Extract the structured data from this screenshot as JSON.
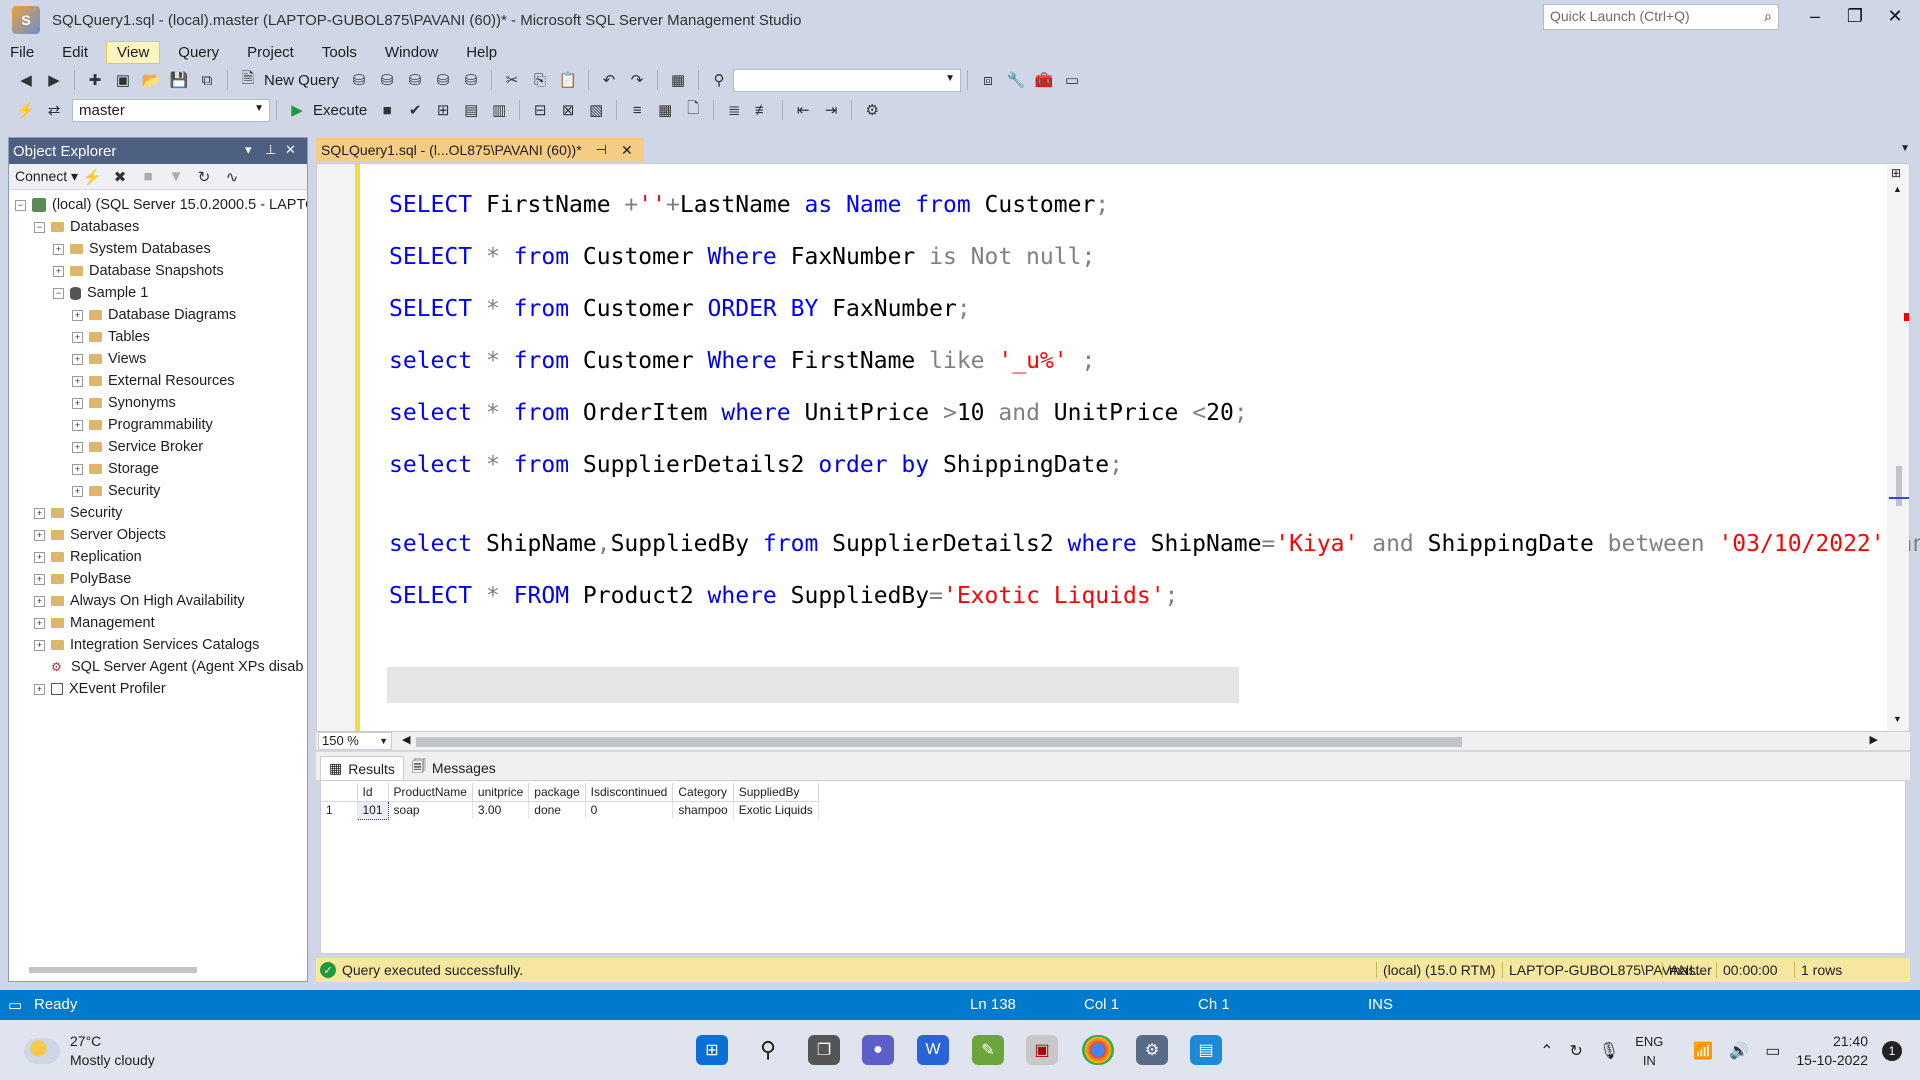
{
  "window": {
    "title": "SQLQuery1.sql - (local).master (LAPTOP-GUBOL875\\PAVANI (60))* - Microsoft SQL Server Management Studio",
    "quick_launch_placeholder": "Quick Launch (Ctrl+Q)"
  },
  "menu": [
    "File",
    "Edit",
    "View",
    "Query",
    "Project",
    "Tools",
    "Window",
    "Help"
  ],
  "menu_active": "View",
  "toolbar1": {
    "new_query_label": "New Query"
  },
  "toolbar2": {
    "database": "master",
    "execute_label": "Execute"
  },
  "object_explorer": {
    "title": "Object Explorer",
    "connect_label": "Connect",
    "tree": [
      {
        "label": "(local) (SQL Server 15.0.2000.5 - LAPTO",
        "indent": 0,
        "exp": "−",
        "icon": "server"
      },
      {
        "label": "Databases",
        "indent": 1,
        "exp": "−",
        "icon": "folder"
      },
      {
        "label": "System Databases",
        "indent": 2,
        "exp": "+",
        "icon": "folder"
      },
      {
        "label": "Database Snapshots",
        "indent": 2,
        "exp": "+",
        "icon": "folder"
      },
      {
        "label": "Sample 1",
        "indent": 2,
        "exp": "−",
        "icon": "db"
      },
      {
        "label": "Database Diagrams",
        "indent": 3,
        "exp": "+",
        "icon": "folder"
      },
      {
        "label": "Tables",
        "indent": 3,
        "exp": "+",
        "icon": "folder"
      },
      {
        "label": "Views",
        "indent": 3,
        "exp": "+",
        "icon": "folder"
      },
      {
        "label": "External Resources",
        "indent": 3,
        "exp": "+",
        "icon": "folder"
      },
      {
        "label": "Synonyms",
        "indent": 3,
        "exp": "+",
        "icon": "folder"
      },
      {
        "label": "Programmability",
        "indent": 3,
        "exp": "+",
        "icon": "folder"
      },
      {
        "label": "Service Broker",
        "indent": 3,
        "exp": "+",
        "icon": "folder"
      },
      {
        "label": "Storage",
        "indent": 3,
        "exp": "+",
        "icon": "folder"
      },
      {
        "label": "Security",
        "indent": 3,
        "exp": "+",
        "icon": "folder"
      },
      {
        "label": "Security",
        "indent": 1,
        "exp": "+",
        "icon": "folder"
      },
      {
        "label": "Server Objects",
        "indent": 1,
        "exp": "+",
        "icon": "folder"
      },
      {
        "label": "Replication",
        "indent": 1,
        "exp": "+",
        "icon": "folder"
      },
      {
        "label": "PolyBase",
        "indent": 1,
        "exp": "+",
        "icon": "folder"
      },
      {
        "label": "Always On High Availability",
        "indent": 1,
        "exp": "+",
        "icon": "folder"
      },
      {
        "label": "Management",
        "indent": 1,
        "exp": "+",
        "icon": "folder"
      },
      {
        "label": "Integration Services Catalogs",
        "indent": 1,
        "exp": "+",
        "icon": "folder"
      },
      {
        "label": "SQL Server Agent (Agent XPs disab",
        "indent": 1,
        "exp": "",
        "icon": "agent"
      },
      {
        "label": "XEvent Profiler",
        "indent": 1,
        "exp": "+",
        "icon": "xe"
      }
    ]
  },
  "doc_tab": {
    "label": "SQLQuery1.sql - (l...OL875\\PAVANI (60))*"
  },
  "editor": {
    "lines": [
      [
        [
          "kw",
          "SELECT"
        ],
        [
          "id",
          " FirstName "
        ],
        [
          "op",
          "+"
        ],
        [
          "str",
          "''"
        ],
        [
          "op",
          "+"
        ],
        [
          "id",
          "LastName "
        ],
        [
          "kw",
          "as"
        ],
        [
          "id",
          " "
        ],
        [
          "kw",
          "Name"
        ],
        [
          "id",
          " "
        ],
        [
          "kw",
          "from"
        ],
        [
          "id",
          " Customer"
        ],
        [
          "op",
          ";"
        ]
      ],
      [
        [
          "kw",
          "SELECT"
        ],
        [
          "id",
          " "
        ],
        [
          "op",
          "*"
        ],
        [
          "id",
          " "
        ],
        [
          "kw",
          "from"
        ],
        [
          "id",
          " Customer "
        ],
        [
          "kw",
          "Where"
        ],
        [
          "id",
          " FaxNumber "
        ],
        [
          "op",
          "is Not null;"
        ]
      ],
      [
        [
          "kw",
          "SELECT"
        ],
        [
          "id",
          " "
        ],
        [
          "op",
          "*"
        ],
        [
          "id",
          " "
        ],
        [
          "kw",
          "from"
        ],
        [
          "id",
          " Customer "
        ],
        [
          "kw",
          "ORDER BY"
        ],
        [
          "id",
          " FaxNumber"
        ],
        [
          "op",
          ";"
        ]
      ],
      [
        [
          "kw",
          "select"
        ],
        [
          "id",
          " "
        ],
        [
          "op",
          "*"
        ],
        [
          "id",
          " "
        ],
        [
          "kw",
          "from"
        ],
        [
          "id",
          " Customer "
        ],
        [
          "kw",
          "Where"
        ],
        [
          "id",
          " FirstName  "
        ],
        [
          "op",
          "like"
        ],
        [
          "id",
          " "
        ],
        [
          "str",
          "'_u%'"
        ],
        [
          "id",
          " "
        ],
        [
          "op",
          ";"
        ]
      ],
      [
        [
          "kw",
          "select"
        ],
        [
          "id",
          " "
        ],
        [
          "op",
          "*"
        ],
        [
          "id",
          " "
        ],
        [
          "kw",
          "from"
        ],
        [
          "id",
          " OrderItem "
        ],
        [
          "kw",
          "where"
        ],
        [
          "id",
          " UnitPrice "
        ],
        [
          "op",
          ">"
        ],
        [
          "id",
          "10 "
        ],
        [
          "op",
          "and"
        ],
        [
          "id",
          " UnitPrice "
        ],
        [
          "op",
          "<"
        ],
        [
          "id",
          "20"
        ],
        [
          "op",
          ";"
        ]
      ],
      [
        [
          "kw",
          "select"
        ],
        [
          "id",
          " "
        ],
        [
          "op",
          "*"
        ],
        [
          "id",
          " "
        ],
        [
          "kw",
          "from"
        ],
        [
          "id",
          " SupplierDetails2 "
        ],
        [
          "kw",
          "order by"
        ],
        [
          "id",
          " ShippingDate"
        ],
        [
          "op",
          ";"
        ]
      ],
      [
        [
          "kw",
          "select"
        ],
        [
          "id",
          " ShipName"
        ],
        [
          "op",
          ","
        ],
        [
          "id",
          "SuppliedBy "
        ],
        [
          "kw",
          "from"
        ],
        [
          "id",
          " SupplierDetails2 "
        ],
        [
          "kw",
          "where"
        ],
        [
          "id",
          " ShipName"
        ],
        [
          "op",
          "="
        ],
        [
          "str",
          "'Kiya'"
        ],
        [
          "id",
          " "
        ],
        [
          "op",
          "and"
        ],
        [
          "id",
          " ShippingDate "
        ],
        [
          "op",
          "between"
        ],
        [
          "id",
          " "
        ],
        [
          "str",
          "'03/10/2022'"
        ],
        [
          "id",
          " "
        ],
        [
          "op",
          "and"
        ]
      ],
      [
        [
          "kw",
          "SELECT"
        ],
        [
          "id",
          " "
        ],
        [
          "op",
          "*"
        ],
        [
          "id",
          " "
        ],
        [
          "kw",
          "FROM"
        ],
        [
          "id",
          " Product2 "
        ],
        [
          "kw",
          "where"
        ],
        [
          "id",
          " SuppliedBy"
        ],
        [
          "op",
          "="
        ],
        [
          "str",
          "'Exotic Liquids'"
        ],
        [
          "op",
          ";"
        ]
      ]
    ],
    "zoom": "150 %"
  },
  "results": {
    "tab_results": "Results",
    "tab_messages": "Messages",
    "columns": [
      "Id",
      "ProductName",
      "unitprice",
      "package",
      "Isdiscontinued",
      "Category",
      "SuppliedBy"
    ],
    "rows": [
      {
        "rownum": "1",
        "cells": [
          "101",
          "soap",
          "3.00",
          "done",
          "0",
          "shampoo",
          "Exotic Liquids"
        ]
      }
    ]
  },
  "query_status": {
    "message": "Query executed successfully.",
    "server": "(local) (15.0 RTM)",
    "user": "LAPTOP-GUBOL875\\PAVANI...",
    "database": "master",
    "time": "00:00:00",
    "rows": "1 rows"
  },
  "status_bar": {
    "state": "Ready",
    "ln": "Ln 138",
    "col": "Col 1",
    "ch": "Ch 1",
    "mode": "INS"
  },
  "taskbar": {
    "temp": "27°C",
    "weather": "Mostly cloudy",
    "lang1": "ENG",
    "lang2": "IN",
    "time": "21:40",
    "date": "15-10-2022",
    "notifications": "1"
  }
}
